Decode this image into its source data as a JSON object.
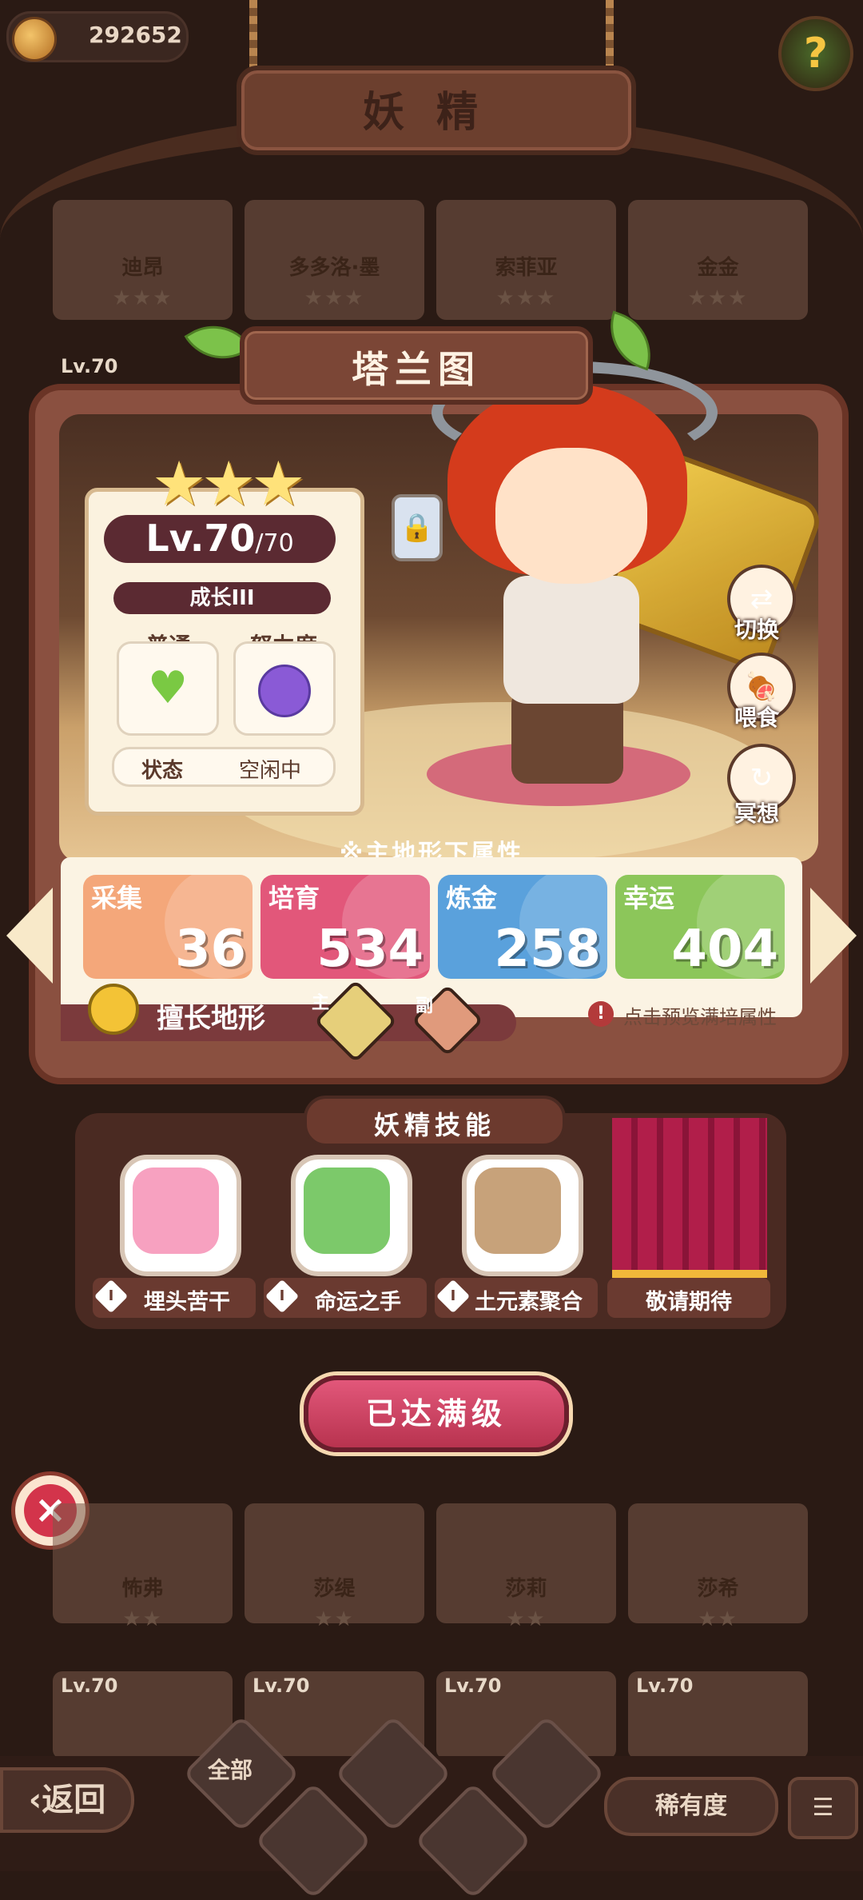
{
  "top": {
    "coins": "292652",
    "title": "妖精"
  },
  "grid_top": [
    {
      "name": "迪昂",
      "stars": "★★★"
    },
    {
      "name": "多多洛·墨",
      "stars": "★★★"
    },
    {
      "name": "索菲亚",
      "stars": "★★★"
    },
    {
      "name": "金金",
      "stars": "★★★"
    }
  ],
  "grid_level": "Lv.70",
  "grid_bottom": [
    {
      "name": "怖弗",
      "stars": "★★"
    },
    {
      "name": "莎缇",
      "stars": "★★"
    },
    {
      "name": "莎莉",
      "stars": "★★"
    },
    {
      "name": "莎希",
      "stars": "★★"
    }
  ],
  "grid_bottom_level": "Lv.70",
  "fairy": {
    "name": "塔兰图",
    "stars": "★★★",
    "level": "Lv.70",
    "level_max": "/70",
    "growth": "成长III",
    "mood_label": "普通",
    "effort_label": "努力度",
    "status_label": "状态",
    "status_value": "空闲中"
  },
  "side_actions": {
    "switch": "切换",
    "feed": "喂食",
    "meditate": "冥想"
  },
  "attributes": {
    "header": "※主地形下属性",
    "items": [
      {
        "name": "采集",
        "value": "36",
        "color": "#f4a77a"
      },
      {
        "name": "培育",
        "value": "534",
        "color": "#e2577a"
      },
      {
        "name": "炼金",
        "value": "258",
        "color": "#5aa1dc"
      },
      {
        "name": "幸运",
        "value": "404",
        "color": "#8cc65a"
      }
    ],
    "terrain_label": "擅长地形",
    "main_tag": "主",
    "sub_tag": "副",
    "preview_hint": "点击预览满培属性"
  },
  "skills": {
    "title": "妖精技能",
    "items": [
      {
        "num": "I",
        "name": "埋头苦干",
        "color": "#f7a1c0"
      },
      {
        "num": "I",
        "name": "命运之手",
        "color": "#7cc96a"
      },
      {
        "num": "I",
        "name": "土元素聚合",
        "color": "#c7a27a"
      }
    ],
    "coming_soon": "敬请期待"
  },
  "max_button": "已达满级",
  "bottom": {
    "back": "返回",
    "all": "全部",
    "rarity": "稀有度",
    "sort_icon": "☰"
  }
}
